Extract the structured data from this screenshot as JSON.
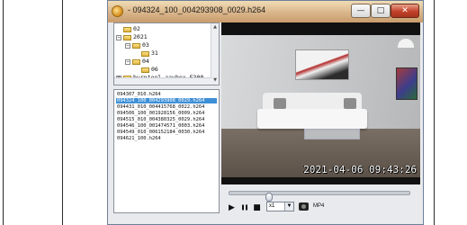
{
  "window": {
    "title": "- 094324_100_004293908_0029.h264",
    "minimize": "—",
    "maximize": "□",
    "close": "✕"
  },
  "tree": {
    "nodes": [
      {
        "label": "02",
        "expander": "",
        "depth": 0
      },
      {
        "label": "2021",
        "expander": "−",
        "depth": 0
      },
      {
        "label": "03",
        "expander": "−",
        "depth": 1
      },
      {
        "label": "31",
        "expander": "",
        "depth": 2
      },
      {
        "label": "04",
        "expander": "−",
        "depth": 1
      },
      {
        "label": "06",
        "expander": "",
        "depth": 2
      },
      {
        "label": "burntool-aaybox-F300",
        "expander": "+",
        "depth": 0
      }
    ]
  },
  "files": [
    {
      "name": "094307_010.h264",
      "selected": false
    },
    {
      "name": "094324_100_004293908_0029.h264",
      "selected": true
    },
    {
      "name": "094431_010_004415768_0022.h264",
      "selected": false
    },
    {
      "name": "094506_100_001928156_0009.h264",
      "selected": false
    },
    {
      "name": "094515_010_004380325_0029.h264",
      "selected": false
    },
    {
      "name": "094546_100_001474571_0003.h264",
      "selected": false
    },
    {
      "name": "094549_010_006152184_0030.h264",
      "selected": false
    },
    {
      "name": "094621_100.h264",
      "selected": false
    }
  ],
  "video": {
    "timestamp": "2021-04-06 09:43:26"
  },
  "controls": {
    "seek_position": 0.22,
    "play": "▶",
    "pause": "❚❚",
    "stop": "■",
    "speed": "x1",
    "speed_arrow": "▼",
    "format": "MP4"
  }
}
